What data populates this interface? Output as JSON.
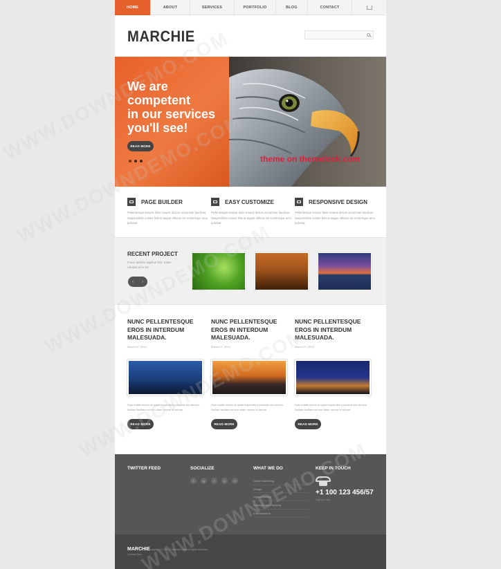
{
  "nav": {
    "items": [
      "HOME",
      "ABOUT",
      "SERVICES",
      "PORTFOLIO",
      "BLOG",
      "CONTACT"
    ],
    "active": "HOME",
    "home_icon": "house-icon"
  },
  "header": {
    "logo": "MARCHIE",
    "search_placeholder": "",
    "search_icon": "search-icon"
  },
  "hero": {
    "title_lines": [
      "We are",
      "competent",
      "in our services",
      "you'll see!"
    ],
    "button": "READ MORE",
    "caption": "theme on themelock.com",
    "slides": 3,
    "accent": "#e6602c"
  },
  "features": [
    {
      "title": "PAGE BUILDER",
      "icon": "layout-icon",
      "text": "Pellentesque tempor dolor mauris dictum accumsan faucibus. Suspendisse cursus felis id augue ultrices vel scelerisque arcu pulvinar."
    },
    {
      "title": "EASY CUSTOMIZE",
      "icon": "monitor-icon",
      "text": "Pellentesque tempor dolor mauris dictum accumsan faucibus. Suspendisse cursus felis id augue ultrices vel scelerisque arcu pulvinar."
    },
    {
      "title": "RESPONSIVE DESIGN",
      "icon": "arrows-icon",
      "text": "Pellentesque tempor dolor mauris dictum accumsan faucibus. Suspendisse cursus felis id augue ultrices vel scelerisque arcu pulvinar."
    }
  ],
  "recent": {
    "title": "RECENT PROJECT",
    "text": "Fusce facilisis dapibus felis. Etiam volutpat arcu vel"
  },
  "posts": [
    {
      "title": "NUNC PELLENTESQUE EROS IN INTERDUM MALESUADA.",
      "date": "March 07, 2014",
      "text": "Duis mattis metus ut quam imperdiet a placerat est ultrices. Nullam facilisis est non diam ornare ut rutrum.",
      "button": "READ MORE"
    },
    {
      "title": "NUNC PELLENTESQUE EROS IN INTERDUM MALESUADA.",
      "date": "March 07, 2014",
      "text": "Duis mattis metus ut quam imperdiet a placerat est ultrices. Nullam facilisis est non diam ornare ut rutrum.",
      "button": "READ MORE"
    },
    {
      "title": "NUNC PELLENTESQUE EROS IN INTERDUM MALESUADA.",
      "date": "March 07, 2014",
      "text": "Duis mattis metus ut quam imperdiet a placerat est ultrices. Nullam facilisis est non diam ornare ut rutrum.",
      "button": "READ MORE"
    }
  ],
  "footer": {
    "twitter_title": "TWITTER FEED",
    "socialize_title": "SOCIALIZE",
    "social_icons": [
      "twitter-icon",
      "google-plus-icon",
      "rss-icon",
      "pinterest-icon",
      "dribbble-icon"
    ],
    "whatwedo_title": "WHAT WE DO",
    "whatwedo_items": [
      "Online Marketing",
      "Design",
      "Digital Printing",
      "Strategic and Planning",
      "Entertainment"
    ],
    "keepintouch_title": "KEEP IN TOUCH",
    "phone": "+1 100 123 456/57",
    "phone_sub": "Call us now",
    "brand": "MARCHIE",
    "copyright": "Copyright © 2014 Company name All rights reserved.",
    "contact": "Contact Now"
  },
  "watermark": "WWW.DOWNDEMO.COM"
}
